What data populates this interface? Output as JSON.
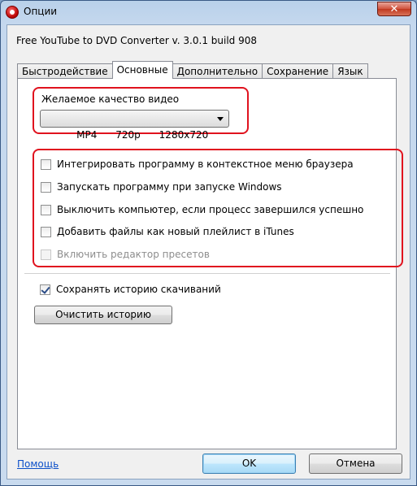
{
  "window": {
    "title": "Опции",
    "close_label": "✕"
  },
  "app_version": "Free YouTube to DVD Converter  v. 3.0.1 build 908",
  "tabs": [
    {
      "label": "Быстродействие",
      "active": false
    },
    {
      "label": "Основные",
      "active": true
    },
    {
      "label": "Дополнительно",
      "active": false
    },
    {
      "label": "Сохранение",
      "active": false
    },
    {
      "label": "Язык",
      "active": false
    }
  ],
  "quality": {
    "label": "Желаемое качество видео",
    "selected_value": "MP4      720p      1280x720"
  },
  "options": [
    {
      "label": "Интегрировать программу в контекстное меню браузера",
      "checked": false,
      "disabled": false
    },
    {
      "label": "Запускать программу при запуске Windows",
      "checked": false,
      "disabled": false
    },
    {
      "label": "Выключить компьютер, если процесс завершился успешно",
      "checked": false,
      "disabled": false
    },
    {
      "label": "Добавить файлы как новый плейлист в iTunes",
      "checked": false,
      "disabled": false
    },
    {
      "label": "Включить редактор пресетов",
      "checked": false,
      "disabled": true
    }
  ],
  "history": {
    "save_label": "Сохранять историю скачиваний",
    "save_checked": true,
    "clear_button": "Очистить историю"
  },
  "footer": {
    "help_link": "Помощь",
    "ok_button": "OK",
    "cancel_button": "Отмена"
  },
  "colors": {
    "highlight_border": "#e0121e",
    "link": "#0b4fc9"
  }
}
